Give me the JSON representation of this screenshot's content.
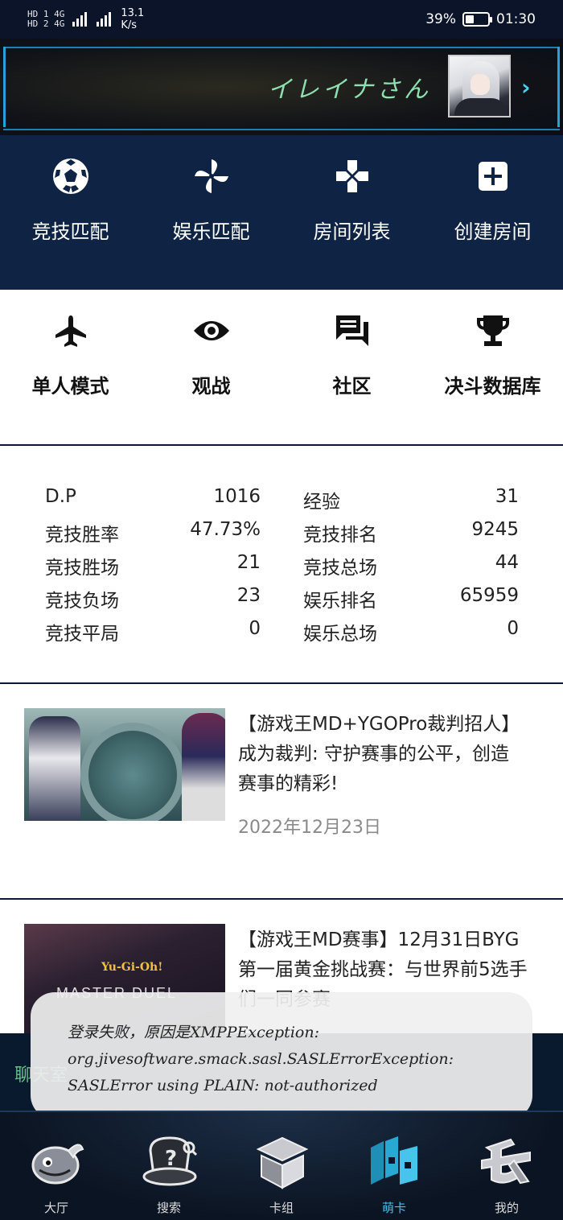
{
  "status_bar": {
    "net1": "HD 1 4G",
    "net2": "HD 2 4G",
    "speed_value": "13.1",
    "speed_unit": "K/s",
    "battery": "39%",
    "battery_level": 0.39,
    "time": "01:30"
  },
  "profile": {
    "username": "イレイナさん"
  },
  "main_menu": [
    {
      "label": "竞技匹配",
      "icon": "soccer-ball-icon"
    },
    {
      "label": "娱乐匹配",
      "icon": "pinwheel-icon"
    },
    {
      "label": "房间列表",
      "icon": "gamepad-icon"
    },
    {
      "label": "创建房间",
      "icon": "plus-square-icon"
    }
  ],
  "sub_menu": [
    {
      "label": "单人模式",
      "icon": "airplane-icon"
    },
    {
      "label": "观战",
      "icon": "eye-icon"
    },
    {
      "label": "社区",
      "icon": "chat-bubbles-icon"
    },
    {
      "label": "决斗数据库",
      "icon": "trophy-icon"
    }
  ],
  "stats_left": [
    {
      "label": "D.P",
      "value": "1016"
    },
    {
      "label": "竞技胜率",
      "value": "47.73%"
    },
    {
      "label": "竞技胜场",
      "value": "21"
    },
    {
      "label": "竞技负场",
      "value": "23"
    },
    {
      "label": "竞技平局",
      "value": "0"
    }
  ],
  "stats_right": [
    {
      "label": "经验",
      "value": "31"
    },
    {
      "label": "竞技排名",
      "value": "9245"
    },
    {
      "label": "竞技总场",
      "value": "44"
    },
    {
      "label": "娱乐排名",
      "value": "65959"
    },
    {
      "label": "娱乐总场",
      "value": "0"
    }
  ],
  "news": [
    {
      "title": "【游戏王MD+YGOPro裁判招人】成为裁判: 守护赛事的公平，创造赛事的精彩!",
      "date": "2022年12月23日"
    },
    {
      "title": "【游戏王MD赛事】12月31日BYG第一届黄金挑战赛：与世界前5选手们一同参赛",
      "thumb_logo": "Yu-Gi-Oh!",
      "thumb_text": "MASTER DUEL"
    }
  ],
  "strip_text": "聊天室",
  "toast": {
    "line1": "登录失败，原因是XMPPException:",
    "line2": "org.jivesoftware.smack.sasl.SASLErrorException:",
    "line3": "SASLError using PLAIN: not-authorized"
  },
  "bottom_nav": [
    {
      "label": "大厅",
      "icon": "bird-icon",
      "active": false
    },
    {
      "label": "搜索",
      "icon": "mystery-hat-icon",
      "active": false
    },
    {
      "label": "卡组",
      "icon": "card-box-icon",
      "active": false
    },
    {
      "label": "萌卡",
      "icon": "mycard-logo-icon",
      "active": true
    },
    {
      "label": "我的",
      "icon": "me-glyph-icon",
      "active": false
    }
  ]
}
